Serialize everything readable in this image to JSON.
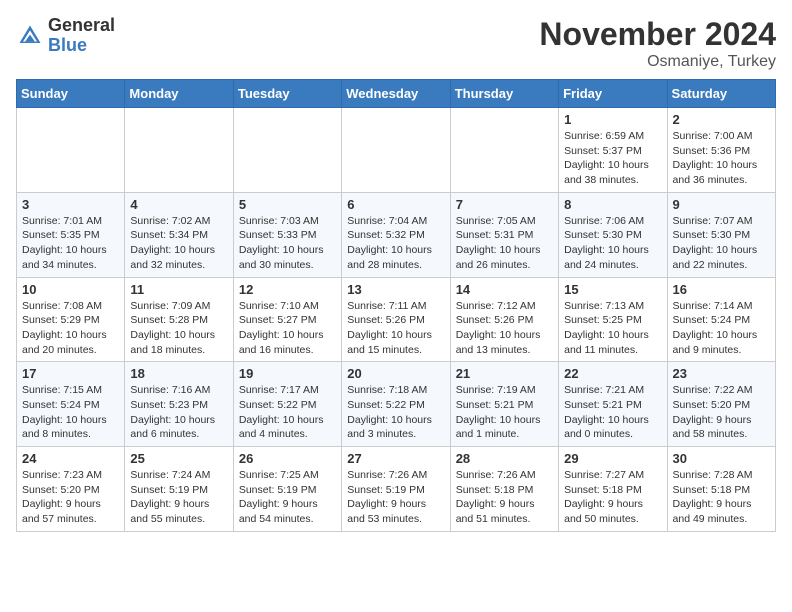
{
  "header": {
    "logo_line1": "General",
    "logo_line2": "Blue",
    "month": "November 2024",
    "location": "Osmaniye, Turkey"
  },
  "weekdays": [
    "Sunday",
    "Monday",
    "Tuesday",
    "Wednesday",
    "Thursday",
    "Friday",
    "Saturday"
  ],
  "weeks": [
    [
      {
        "day": "",
        "info": ""
      },
      {
        "day": "",
        "info": ""
      },
      {
        "day": "",
        "info": ""
      },
      {
        "day": "",
        "info": ""
      },
      {
        "day": "",
        "info": ""
      },
      {
        "day": "1",
        "info": "Sunrise: 6:59 AM\nSunset: 5:37 PM\nDaylight: 10 hours\nand 38 minutes."
      },
      {
        "day": "2",
        "info": "Sunrise: 7:00 AM\nSunset: 5:36 PM\nDaylight: 10 hours\nand 36 minutes."
      }
    ],
    [
      {
        "day": "3",
        "info": "Sunrise: 7:01 AM\nSunset: 5:35 PM\nDaylight: 10 hours\nand 34 minutes."
      },
      {
        "day": "4",
        "info": "Sunrise: 7:02 AM\nSunset: 5:34 PM\nDaylight: 10 hours\nand 32 minutes."
      },
      {
        "day": "5",
        "info": "Sunrise: 7:03 AM\nSunset: 5:33 PM\nDaylight: 10 hours\nand 30 minutes."
      },
      {
        "day": "6",
        "info": "Sunrise: 7:04 AM\nSunset: 5:32 PM\nDaylight: 10 hours\nand 28 minutes."
      },
      {
        "day": "7",
        "info": "Sunrise: 7:05 AM\nSunset: 5:31 PM\nDaylight: 10 hours\nand 26 minutes."
      },
      {
        "day": "8",
        "info": "Sunrise: 7:06 AM\nSunset: 5:30 PM\nDaylight: 10 hours\nand 24 minutes."
      },
      {
        "day": "9",
        "info": "Sunrise: 7:07 AM\nSunset: 5:30 PM\nDaylight: 10 hours\nand 22 minutes."
      }
    ],
    [
      {
        "day": "10",
        "info": "Sunrise: 7:08 AM\nSunset: 5:29 PM\nDaylight: 10 hours\nand 20 minutes."
      },
      {
        "day": "11",
        "info": "Sunrise: 7:09 AM\nSunset: 5:28 PM\nDaylight: 10 hours\nand 18 minutes."
      },
      {
        "day": "12",
        "info": "Sunrise: 7:10 AM\nSunset: 5:27 PM\nDaylight: 10 hours\nand 16 minutes."
      },
      {
        "day": "13",
        "info": "Sunrise: 7:11 AM\nSunset: 5:26 PM\nDaylight: 10 hours\nand 15 minutes."
      },
      {
        "day": "14",
        "info": "Sunrise: 7:12 AM\nSunset: 5:26 PM\nDaylight: 10 hours\nand 13 minutes."
      },
      {
        "day": "15",
        "info": "Sunrise: 7:13 AM\nSunset: 5:25 PM\nDaylight: 10 hours\nand 11 minutes."
      },
      {
        "day": "16",
        "info": "Sunrise: 7:14 AM\nSunset: 5:24 PM\nDaylight: 10 hours\nand 9 minutes."
      }
    ],
    [
      {
        "day": "17",
        "info": "Sunrise: 7:15 AM\nSunset: 5:24 PM\nDaylight: 10 hours\nand 8 minutes."
      },
      {
        "day": "18",
        "info": "Sunrise: 7:16 AM\nSunset: 5:23 PM\nDaylight: 10 hours\nand 6 minutes."
      },
      {
        "day": "19",
        "info": "Sunrise: 7:17 AM\nSunset: 5:22 PM\nDaylight: 10 hours\nand 4 minutes."
      },
      {
        "day": "20",
        "info": "Sunrise: 7:18 AM\nSunset: 5:22 PM\nDaylight: 10 hours\nand 3 minutes."
      },
      {
        "day": "21",
        "info": "Sunrise: 7:19 AM\nSunset: 5:21 PM\nDaylight: 10 hours\nand 1 minute."
      },
      {
        "day": "22",
        "info": "Sunrise: 7:21 AM\nSunset: 5:21 PM\nDaylight: 10 hours\nand 0 minutes."
      },
      {
        "day": "23",
        "info": "Sunrise: 7:22 AM\nSunset: 5:20 PM\nDaylight: 9 hours\nand 58 minutes."
      }
    ],
    [
      {
        "day": "24",
        "info": "Sunrise: 7:23 AM\nSunset: 5:20 PM\nDaylight: 9 hours\nand 57 minutes."
      },
      {
        "day": "25",
        "info": "Sunrise: 7:24 AM\nSunset: 5:19 PM\nDaylight: 9 hours\nand 55 minutes."
      },
      {
        "day": "26",
        "info": "Sunrise: 7:25 AM\nSunset: 5:19 PM\nDaylight: 9 hours\nand 54 minutes."
      },
      {
        "day": "27",
        "info": "Sunrise: 7:26 AM\nSunset: 5:19 PM\nDaylight: 9 hours\nand 53 minutes."
      },
      {
        "day": "28",
        "info": "Sunrise: 7:26 AM\nSunset: 5:18 PM\nDaylight: 9 hours\nand 51 minutes."
      },
      {
        "day": "29",
        "info": "Sunrise: 7:27 AM\nSunset: 5:18 PM\nDaylight: 9 hours\nand 50 minutes."
      },
      {
        "day": "30",
        "info": "Sunrise: 7:28 AM\nSunset: 5:18 PM\nDaylight: 9 hours\nand 49 minutes."
      }
    ]
  ]
}
